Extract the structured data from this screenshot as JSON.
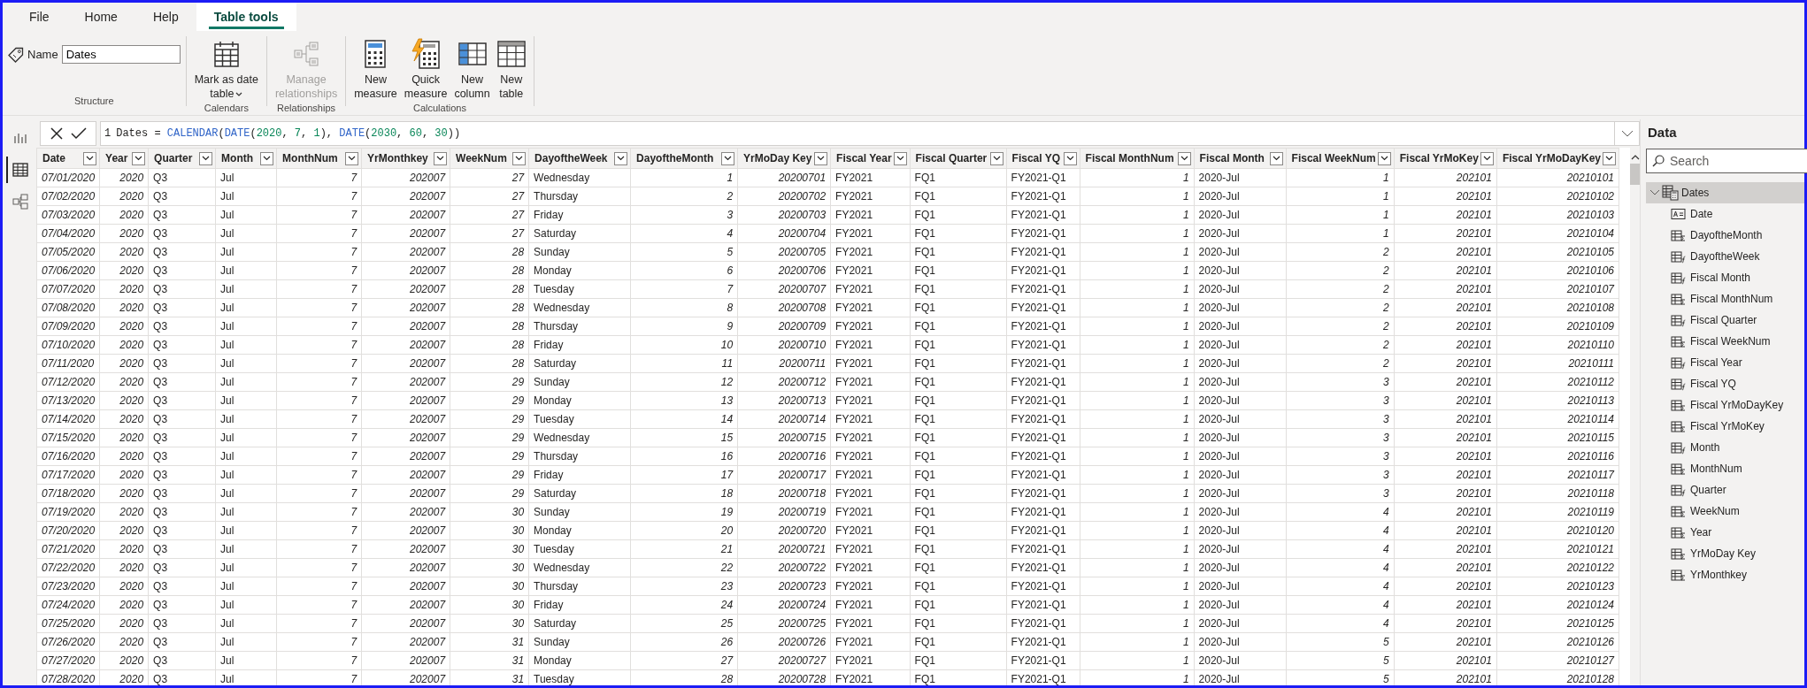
{
  "tabs": [
    {
      "label": "File",
      "selected": false
    },
    {
      "label": "Home",
      "selected": false
    },
    {
      "label": "Help",
      "selected": false
    },
    {
      "label": "Table tools",
      "selected": true
    }
  ],
  "ribbon": {
    "groups": [
      {
        "label": "Structure",
        "kind": "name",
        "field_label": "Name",
        "value": "Dates"
      },
      {
        "label": "Calendars",
        "kind": "buttons",
        "buttons": [
          {
            "label": "Mark as date\ntable",
            "kind": "calendar",
            "dropdown": true,
            "disabled": false
          }
        ]
      },
      {
        "label": "Relationships",
        "kind": "buttons",
        "buttons": [
          {
            "label": "Manage\nrelationships",
            "kind": "relationships",
            "dropdown": false,
            "disabled": true
          }
        ]
      },
      {
        "label": "Calculations",
        "kind": "buttons",
        "buttons": [
          {
            "label": "New\nmeasure",
            "kind": "measure",
            "dropdown": false,
            "disabled": false
          },
          {
            "label": "Quick\nmeasure",
            "kind": "quick-measure",
            "dropdown": false,
            "disabled": false
          },
          {
            "label": "New\ncolumn",
            "kind": "column",
            "dropdown": false,
            "disabled": false
          },
          {
            "label": "New\ntable",
            "kind": "table",
            "dropdown": false,
            "disabled": false
          }
        ]
      }
    ]
  },
  "views": [
    {
      "kind": "report",
      "selected": false
    },
    {
      "kind": "table",
      "selected": true
    },
    {
      "kind": "model",
      "selected": false
    }
  ],
  "formula": {
    "line_number": "1",
    "tokens": [
      {
        "kind": "plain",
        "text": "Dates = "
      },
      {
        "kind": "function",
        "text": "CALENDAR"
      },
      {
        "kind": "plain",
        "text": "("
      },
      {
        "kind": "function",
        "text": "DATE"
      },
      {
        "kind": "plain",
        "text": "("
      },
      {
        "kind": "number",
        "text": "2020"
      },
      {
        "kind": "plain",
        "text": ", "
      },
      {
        "kind": "number",
        "text": "7"
      },
      {
        "kind": "plain",
        "text": ", "
      },
      {
        "kind": "number",
        "text": "1"
      },
      {
        "kind": "plain",
        "text": "), "
      },
      {
        "kind": "function",
        "text": "DATE"
      },
      {
        "kind": "plain",
        "text": "("
      },
      {
        "kind": "number",
        "text": "2030"
      },
      {
        "kind": "plain",
        "text": ", "
      },
      {
        "kind": "number",
        "text": "60"
      },
      {
        "kind": "plain",
        "text": ", "
      },
      {
        "kind": "number",
        "text": "30"
      },
      {
        "kind": "plain",
        "text": "))"
      }
    ]
  },
  "table": {
    "columns": [
      {
        "label": "Date",
        "kind": "date"
      },
      {
        "label": "Year",
        "kind": "number"
      },
      {
        "label": "Quarter",
        "kind": "text"
      },
      {
        "label": "Month",
        "kind": "text"
      },
      {
        "label": "MonthNum",
        "kind": "number"
      },
      {
        "label": "YrMonthkey",
        "kind": "number"
      },
      {
        "label": "WeekNum",
        "kind": "number"
      },
      {
        "label": "DayoftheWeek",
        "kind": "text"
      },
      {
        "label": "DayoftheMonth",
        "kind": "number"
      },
      {
        "label": "YrMoDay Key",
        "kind": "number"
      },
      {
        "label": "Fiscal Year",
        "kind": "text"
      },
      {
        "label": "Fiscal Quarter",
        "kind": "text"
      },
      {
        "label": "Fiscal YQ",
        "kind": "text"
      },
      {
        "label": "Fiscal MonthNum",
        "kind": "number"
      },
      {
        "label": "Fiscal Month",
        "kind": "text"
      },
      {
        "label": "Fiscal WeekNum",
        "kind": "number"
      },
      {
        "label": "Fiscal YrMoKey",
        "kind": "number"
      },
      {
        "label": "Fiscal YrMoDayKey",
        "kind": "number"
      }
    ],
    "rows": [
      [
        "07/01/2020",
        "2020",
        "Q3",
        "Jul",
        "7",
        "202007",
        "27",
        "Wednesday",
        "1",
        "20200701",
        "FY2021",
        "FQ1",
        "FY2021-Q1",
        "1",
        "2020-Jul",
        "1",
        "202101",
        "20210101"
      ],
      [
        "07/02/2020",
        "2020",
        "Q3",
        "Jul",
        "7",
        "202007",
        "27",
        "Thursday",
        "2",
        "20200702",
        "FY2021",
        "FQ1",
        "FY2021-Q1",
        "1",
        "2020-Jul",
        "1",
        "202101",
        "20210102"
      ],
      [
        "07/03/2020",
        "2020",
        "Q3",
        "Jul",
        "7",
        "202007",
        "27",
        "Friday",
        "3",
        "20200703",
        "FY2021",
        "FQ1",
        "FY2021-Q1",
        "1",
        "2020-Jul",
        "1",
        "202101",
        "20210103"
      ],
      [
        "07/04/2020",
        "2020",
        "Q3",
        "Jul",
        "7",
        "202007",
        "27",
        "Saturday",
        "4",
        "20200704",
        "FY2021",
        "FQ1",
        "FY2021-Q1",
        "1",
        "2020-Jul",
        "1",
        "202101",
        "20210104"
      ],
      [
        "07/05/2020",
        "2020",
        "Q3",
        "Jul",
        "7",
        "202007",
        "28",
        "Sunday",
        "5",
        "20200705",
        "FY2021",
        "FQ1",
        "FY2021-Q1",
        "1",
        "2020-Jul",
        "2",
        "202101",
        "20210105"
      ],
      [
        "07/06/2020",
        "2020",
        "Q3",
        "Jul",
        "7",
        "202007",
        "28",
        "Monday",
        "6",
        "20200706",
        "FY2021",
        "FQ1",
        "FY2021-Q1",
        "1",
        "2020-Jul",
        "2",
        "202101",
        "20210106"
      ],
      [
        "07/07/2020",
        "2020",
        "Q3",
        "Jul",
        "7",
        "202007",
        "28",
        "Tuesday",
        "7",
        "20200707",
        "FY2021",
        "FQ1",
        "FY2021-Q1",
        "1",
        "2020-Jul",
        "2",
        "202101",
        "20210107"
      ],
      [
        "07/08/2020",
        "2020",
        "Q3",
        "Jul",
        "7",
        "202007",
        "28",
        "Wednesday",
        "8",
        "20200708",
        "FY2021",
        "FQ1",
        "FY2021-Q1",
        "1",
        "2020-Jul",
        "2",
        "202101",
        "20210108"
      ],
      [
        "07/09/2020",
        "2020",
        "Q3",
        "Jul",
        "7",
        "202007",
        "28",
        "Thursday",
        "9",
        "20200709",
        "FY2021",
        "FQ1",
        "FY2021-Q1",
        "1",
        "2020-Jul",
        "2",
        "202101",
        "20210109"
      ],
      [
        "07/10/2020",
        "2020",
        "Q3",
        "Jul",
        "7",
        "202007",
        "28",
        "Friday",
        "10",
        "20200710",
        "FY2021",
        "FQ1",
        "FY2021-Q1",
        "1",
        "2020-Jul",
        "2",
        "202101",
        "20210110"
      ],
      [
        "07/11/2020",
        "2020",
        "Q3",
        "Jul",
        "7",
        "202007",
        "28",
        "Saturday",
        "11",
        "20200711",
        "FY2021",
        "FQ1",
        "FY2021-Q1",
        "1",
        "2020-Jul",
        "2",
        "202101",
        "20210111"
      ],
      [
        "07/12/2020",
        "2020",
        "Q3",
        "Jul",
        "7",
        "202007",
        "29",
        "Sunday",
        "12",
        "20200712",
        "FY2021",
        "FQ1",
        "FY2021-Q1",
        "1",
        "2020-Jul",
        "3",
        "202101",
        "20210112"
      ],
      [
        "07/13/2020",
        "2020",
        "Q3",
        "Jul",
        "7",
        "202007",
        "29",
        "Monday",
        "13",
        "20200713",
        "FY2021",
        "FQ1",
        "FY2021-Q1",
        "1",
        "2020-Jul",
        "3",
        "202101",
        "20210113"
      ],
      [
        "07/14/2020",
        "2020",
        "Q3",
        "Jul",
        "7",
        "202007",
        "29",
        "Tuesday",
        "14",
        "20200714",
        "FY2021",
        "FQ1",
        "FY2021-Q1",
        "1",
        "2020-Jul",
        "3",
        "202101",
        "20210114"
      ],
      [
        "07/15/2020",
        "2020",
        "Q3",
        "Jul",
        "7",
        "202007",
        "29",
        "Wednesday",
        "15",
        "20200715",
        "FY2021",
        "FQ1",
        "FY2021-Q1",
        "1",
        "2020-Jul",
        "3",
        "202101",
        "20210115"
      ],
      [
        "07/16/2020",
        "2020",
        "Q3",
        "Jul",
        "7",
        "202007",
        "29",
        "Thursday",
        "16",
        "20200716",
        "FY2021",
        "FQ1",
        "FY2021-Q1",
        "1",
        "2020-Jul",
        "3",
        "202101",
        "20210116"
      ],
      [
        "07/17/2020",
        "2020",
        "Q3",
        "Jul",
        "7",
        "202007",
        "29",
        "Friday",
        "17",
        "20200717",
        "FY2021",
        "FQ1",
        "FY2021-Q1",
        "1",
        "2020-Jul",
        "3",
        "202101",
        "20210117"
      ],
      [
        "07/18/2020",
        "2020",
        "Q3",
        "Jul",
        "7",
        "202007",
        "29",
        "Saturday",
        "18",
        "20200718",
        "FY2021",
        "FQ1",
        "FY2021-Q1",
        "1",
        "2020-Jul",
        "3",
        "202101",
        "20210118"
      ],
      [
        "07/19/2020",
        "2020",
        "Q3",
        "Jul",
        "7",
        "202007",
        "30",
        "Sunday",
        "19",
        "20200719",
        "FY2021",
        "FQ1",
        "FY2021-Q1",
        "1",
        "2020-Jul",
        "4",
        "202101",
        "20210119"
      ],
      [
        "07/20/2020",
        "2020",
        "Q3",
        "Jul",
        "7",
        "202007",
        "30",
        "Monday",
        "20",
        "20200720",
        "FY2021",
        "FQ1",
        "FY2021-Q1",
        "1",
        "2020-Jul",
        "4",
        "202101",
        "20210120"
      ],
      [
        "07/21/2020",
        "2020",
        "Q3",
        "Jul",
        "7",
        "202007",
        "30",
        "Tuesday",
        "21",
        "20200721",
        "FY2021",
        "FQ1",
        "FY2021-Q1",
        "1",
        "2020-Jul",
        "4",
        "202101",
        "20210121"
      ],
      [
        "07/22/2020",
        "2020",
        "Q3",
        "Jul",
        "7",
        "202007",
        "30",
        "Wednesday",
        "22",
        "20200722",
        "FY2021",
        "FQ1",
        "FY2021-Q1",
        "1",
        "2020-Jul",
        "4",
        "202101",
        "20210122"
      ],
      [
        "07/23/2020",
        "2020",
        "Q3",
        "Jul",
        "7",
        "202007",
        "30",
        "Thursday",
        "23",
        "20200723",
        "FY2021",
        "FQ1",
        "FY2021-Q1",
        "1",
        "2020-Jul",
        "4",
        "202101",
        "20210123"
      ],
      [
        "07/24/2020",
        "2020",
        "Q3",
        "Jul",
        "7",
        "202007",
        "30",
        "Friday",
        "24",
        "20200724",
        "FY2021",
        "FQ1",
        "FY2021-Q1",
        "1",
        "2020-Jul",
        "4",
        "202101",
        "20210124"
      ],
      [
        "07/25/2020",
        "2020",
        "Q3",
        "Jul",
        "7",
        "202007",
        "30",
        "Saturday",
        "25",
        "20200725",
        "FY2021",
        "FQ1",
        "FY2021-Q1",
        "1",
        "2020-Jul",
        "4",
        "202101",
        "20210125"
      ],
      [
        "07/26/2020",
        "2020",
        "Q3",
        "Jul",
        "7",
        "202007",
        "31",
        "Sunday",
        "26",
        "20200726",
        "FY2021",
        "FQ1",
        "FY2021-Q1",
        "1",
        "2020-Jul",
        "5",
        "202101",
        "20210126"
      ],
      [
        "07/27/2020",
        "2020",
        "Q3",
        "Jul",
        "7",
        "202007",
        "31",
        "Monday",
        "27",
        "20200727",
        "FY2021",
        "FQ1",
        "FY2021-Q1",
        "1",
        "2020-Jul",
        "5",
        "202101",
        "20210127"
      ],
      [
        "07/28/2020",
        "2020",
        "Q3",
        "Jul",
        "7",
        "202007",
        "31",
        "Tuesday",
        "28",
        "20200728",
        "FY2021",
        "FQ1",
        "FY2021-Q1",
        "1",
        "2020-Jul",
        "5",
        "202101",
        "20210128"
      ]
    ]
  },
  "data_panel": {
    "title": "Data",
    "search": {
      "placeholder": "Search"
    },
    "tables": [
      {
        "name": "Dates",
        "expanded": true,
        "fields": [
          {
            "name": "Date",
            "kind": "text"
          },
          {
            "name": "DayoftheMonth",
            "kind": "sum"
          },
          {
            "name": "DayoftheWeek",
            "kind": "calc"
          },
          {
            "name": "Fiscal Month",
            "kind": "calc"
          },
          {
            "name": "Fiscal MonthNum",
            "kind": "sum"
          },
          {
            "name": "Fiscal Quarter",
            "kind": "calc"
          },
          {
            "name": "Fiscal WeekNum",
            "kind": "sum"
          },
          {
            "name": "Fiscal Year",
            "kind": "calc"
          },
          {
            "name": "Fiscal YQ",
            "kind": "calc"
          },
          {
            "name": "Fiscal YrMoDayKey",
            "kind": "sum"
          },
          {
            "name": "Fiscal YrMoKey",
            "kind": "sum"
          },
          {
            "name": "Month",
            "kind": "calc"
          },
          {
            "name": "MonthNum",
            "kind": "sum"
          },
          {
            "name": "Quarter",
            "kind": "calc"
          },
          {
            "name": "WeekNum",
            "kind": "sum"
          },
          {
            "name": "Year",
            "kind": "sum"
          },
          {
            "name": "YrMoDay Key",
            "kind": "sum"
          },
          {
            "name": "YrMonthkey",
            "kind": "sum"
          }
        ]
      }
    ]
  }
}
